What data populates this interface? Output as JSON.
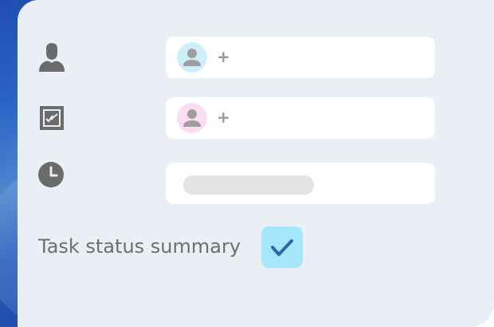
{
  "form": {
    "rows": [
      {
        "icon": "person-icon",
        "field_type": "avatar-picker",
        "avatar_color": "#cdeffb",
        "add_label": "+"
      },
      {
        "icon": "task-check-icon",
        "field_type": "avatar-picker",
        "avatar_color": "#fbdcf2",
        "add_label": "+"
      },
      {
        "icon": "clock-icon",
        "field_type": "text-placeholder"
      }
    ],
    "summary_label": "Task status summary",
    "summary_checked": true
  },
  "colors": {
    "panel_bg": "#eaeff5",
    "field_bg": "#ffffff",
    "icon_gray": "#6b6b6b",
    "checkbox_bg": "#a6e6fb",
    "checkmark": "#2a6aa8",
    "accent_blue": "#2b63c5"
  }
}
